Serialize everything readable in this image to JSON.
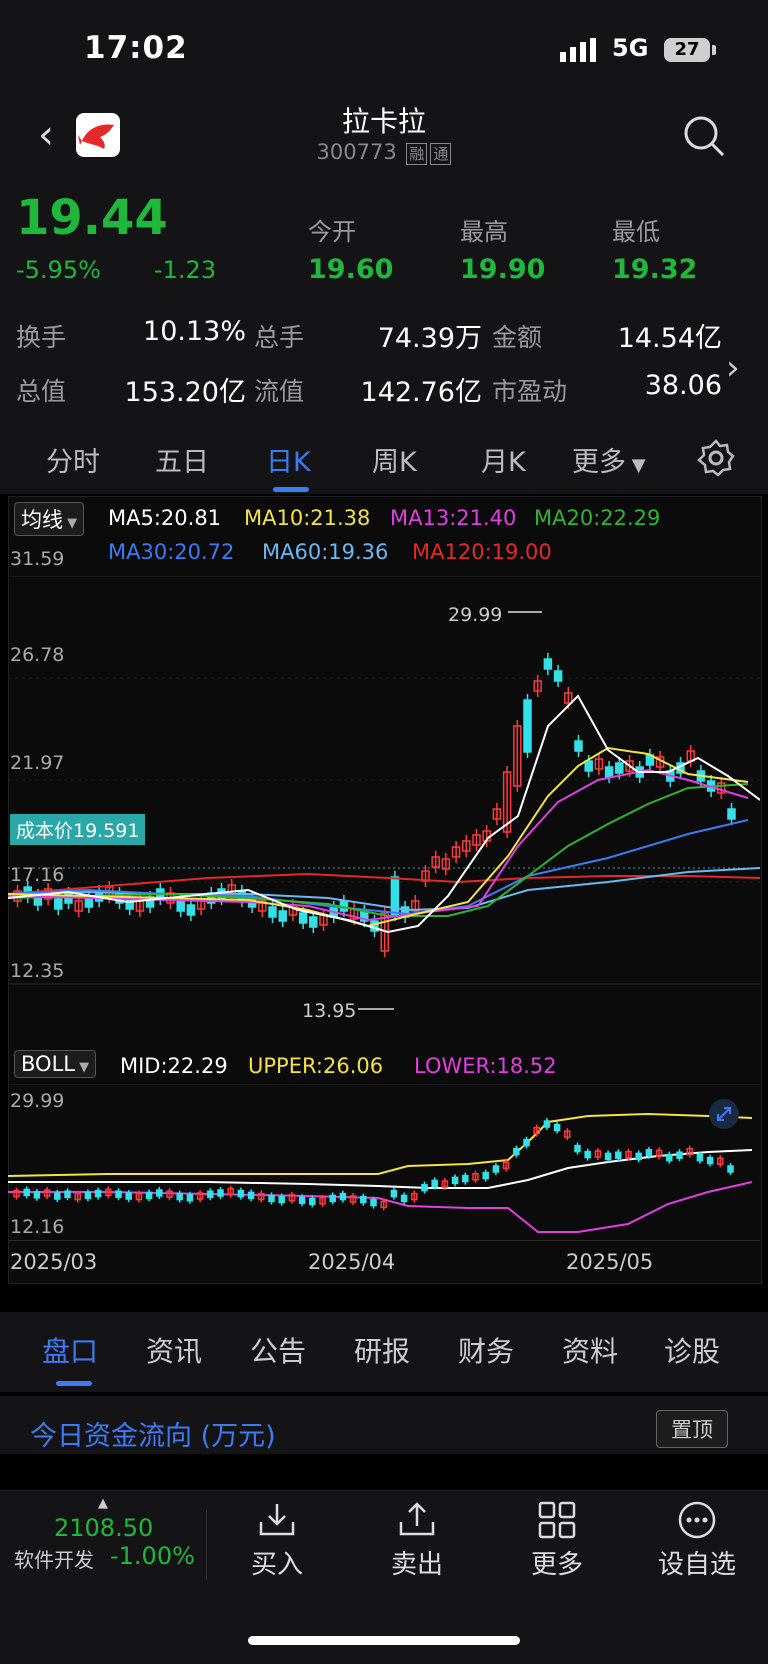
{
  "status": {
    "time": "17:02",
    "network": "5G",
    "battery": "27"
  },
  "header": {
    "title": "拉卡拉",
    "code": "300773",
    "tag1": "融",
    "tag2": "通"
  },
  "quote": {
    "price": "19.44",
    "change_pct": "-5.95%",
    "change": "-1.23",
    "open_label": "今开",
    "open": "19.60",
    "high_label": "最高",
    "high": "19.90",
    "low_label": "最低",
    "low": "19.32",
    "turnover_label": "换手",
    "turnover": "10.13%",
    "volume_label": "总手",
    "volume": "74.39万",
    "amount_label": "金额",
    "amount": "14.54亿",
    "mcap_label": "总值",
    "mcap": "153.20亿",
    "float_label": "流值",
    "float": "142.76亿",
    "pe_label": "市盈动",
    "pe": "38.06"
  },
  "tabs": [
    "分时",
    "五日",
    "日K",
    "周K",
    "月K",
    "更多"
  ],
  "ma_legend": {
    "selector": "均线",
    "items": [
      {
        "text": "MA5:20.81",
        "color": "#ffffff"
      },
      {
        "text": "MA10:21.38",
        "color": "#f5e14a"
      },
      {
        "text": "MA13:21.40",
        "color": "#e040e0"
      },
      {
        "text": "MA20:22.29",
        "color": "#2fb52f"
      },
      {
        "text": "MA30:20.72",
        "color": "#3d7bf4"
      },
      {
        "text": "MA60:19.36",
        "color": "#6cb8f0"
      },
      {
        "text": "MA120:19.00",
        "color": "#e02a2a"
      }
    ]
  },
  "kline": {
    "y_ticks": [
      "31.59",
      "26.78",
      "21.97",
      "17.16",
      "12.35"
    ],
    "cost_label": "成本价19.591",
    "high_marker": "29.99",
    "low_marker": "13.95"
  },
  "boll": {
    "selector": "BOLL",
    "mid": "MID:22.29",
    "upper": "UPPER:26.06",
    "lower": "LOWER:18.52",
    "y_top": "29.99",
    "y_bottom": "12.16"
  },
  "x_axis": [
    "2025/03",
    "2025/04",
    "2025/05"
  ],
  "bottom_tabs": [
    "盘口",
    "资讯",
    "公告",
    "研报",
    "财务",
    "资料",
    "诊股"
  ],
  "flow": {
    "title": "今日资金流向 (万元)",
    "pin": "置顶"
  },
  "footer": {
    "index_value": "2108.50",
    "index_name": "软件开发",
    "index_pct": "-1.00%",
    "buttons": [
      "买入",
      "卖出",
      "更多",
      "设自选"
    ]
  },
  "colors": {
    "up": "#ff3b3b",
    "down": "#1fb83a",
    "accent": "#3d7bf4",
    "candle_down": "#33e0e8"
  }
}
